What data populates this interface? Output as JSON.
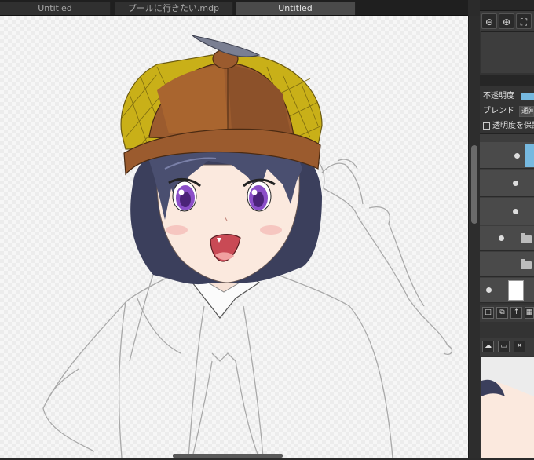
{
  "tabs": [
    {
      "label": "Untitled"
    },
    {
      "label": "プールに行きたい.mdp"
    },
    {
      "label": "Untitled"
    }
  ],
  "panel": {
    "opacity_label": "不透明度",
    "blend_label": "ブレンド",
    "blend_value": "通常",
    "protect_label": "透明度を保護",
    "nav_icons": [
      "zoom-out-icon",
      "zoom-in-icon",
      "fit-icon"
    ],
    "layer_tool_icons": [
      "new-layer-icon",
      "copy-layer-icon",
      "import-layer-icon",
      "grid-layer-icon"
    ],
    "material_tool_icons": [
      "upload-icon",
      "folder-icon",
      "close-icon"
    ],
    "accent_color": "#76b9e0"
  },
  "colors": {
    "hat_brown": "#9b5b2e",
    "hat_yellow": "#c9b018",
    "hair": "#3b3f5c",
    "eyes": "#8b4fc8",
    "skin": "#fbe9de"
  }
}
